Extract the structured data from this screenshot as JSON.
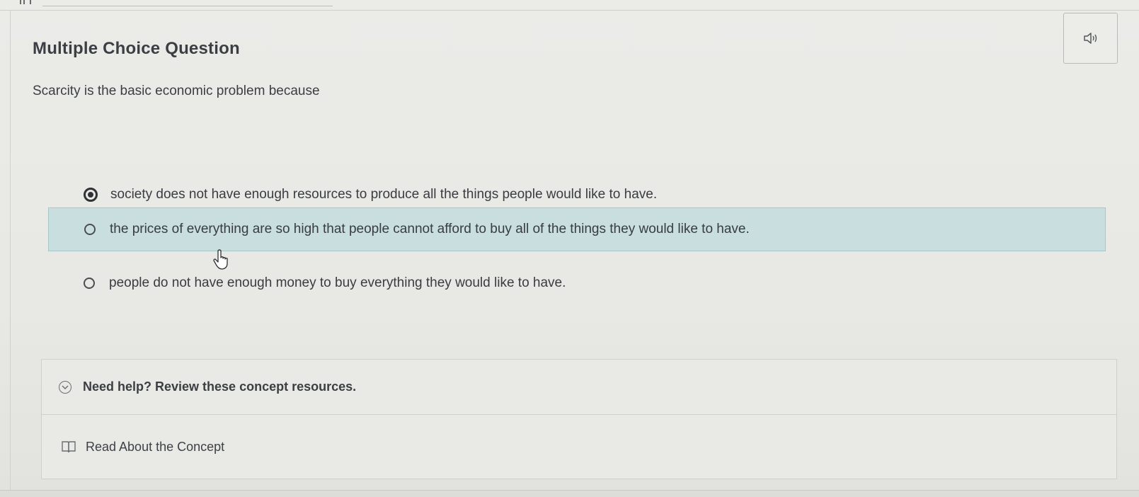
{
  "question": {
    "heading": "Multiple Choice Question",
    "prompt": "Scarcity is the basic economic problem because"
  },
  "options": [
    {
      "text": "society does not have enough resources to produce all the things people would like to have.",
      "selected": true,
      "highlighted": false
    },
    {
      "text": "the prices of everything are so high that people cannot afford to buy all of the things they would like to have.",
      "selected": false,
      "highlighted": true
    },
    {
      "text": "people do not have enough money to buy everything they would like to have.",
      "selected": false,
      "highlighted": false
    }
  ],
  "help": {
    "toggle_label": "Need help? Review these concept resources.",
    "resource_label": "Read About the Concept"
  },
  "icons": {
    "audio": "speaker-icon",
    "toggle": "chevron-down-circle-icon",
    "resource": "book-icon",
    "cursor": "hand-pointer-icon"
  },
  "colors": {
    "highlight_bg": "#c9dedf",
    "text": "#3b3e43"
  }
}
